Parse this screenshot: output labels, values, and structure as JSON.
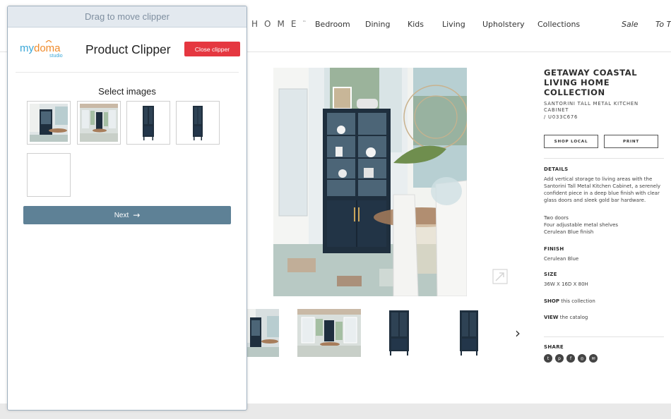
{
  "site": {
    "brand": "HOME",
    "brand_mark": "™",
    "nav": [
      {
        "label": "Bedroom"
      },
      {
        "label": "Dining"
      },
      {
        "label": "Kids"
      },
      {
        "label": "Living"
      },
      {
        "label": "Upholstery"
      },
      {
        "label": "Collections"
      },
      {
        "label": "Sale"
      },
      {
        "label": "To Th"
      }
    ],
    "product": {
      "collection_title": "GETAWAY COASTAL LIVING HOME COLLECTION",
      "product_name": "SANTORINI TALL METAL KITCHEN CABINET",
      "sku": "/ U033C676",
      "shop_local_label": "SHOP LOCAL",
      "print_label": "PRINT",
      "details_label": "DETAILS",
      "details_text": "Add vertical storage to living areas with the Santorini Tall Metal Kitchen Cabinet, a serenely confident piece in a deep blue finish with clear glass doors and sleek gold bar hardware.",
      "features": [
        "Two doors",
        "Four adjustable metal shelves",
        "Cerulean Blue finish"
      ],
      "finish_label": "FINISH",
      "finish_value": "Cerulean Blue",
      "size_label": "SIZE",
      "size_value": "36W X 16D X 80H",
      "shop_bold": "SHOP",
      "shop_text": " this collection",
      "view_bold": "VIEW",
      "view_text": " the catalog",
      "share_label": "SHARE",
      "share_icons": [
        "twitter-icon",
        "pinterest-icon",
        "facebook-icon",
        "instagram-icon",
        "email-icon"
      ]
    },
    "next_arrow": "›"
  },
  "clipper": {
    "drag_label": "Drag to move clipper",
    "logo_text": "mydoma",
    "logo_sub": "studio",
    "title": "Product Clipper",
    "close_label": "Close clipper",
    "select_label": "Select images",
    "next_label": "Next",
    "next_arrow": "→"
  },
  "colors": {
    "close_button": "#e53740",
    "next_button": "#5e8196",
    "cabinet_blue": "#1f2f3e",
    "logo_blue": "#3aa7d8",
    "logo_orange": "#ef8b2c"
  }
}
